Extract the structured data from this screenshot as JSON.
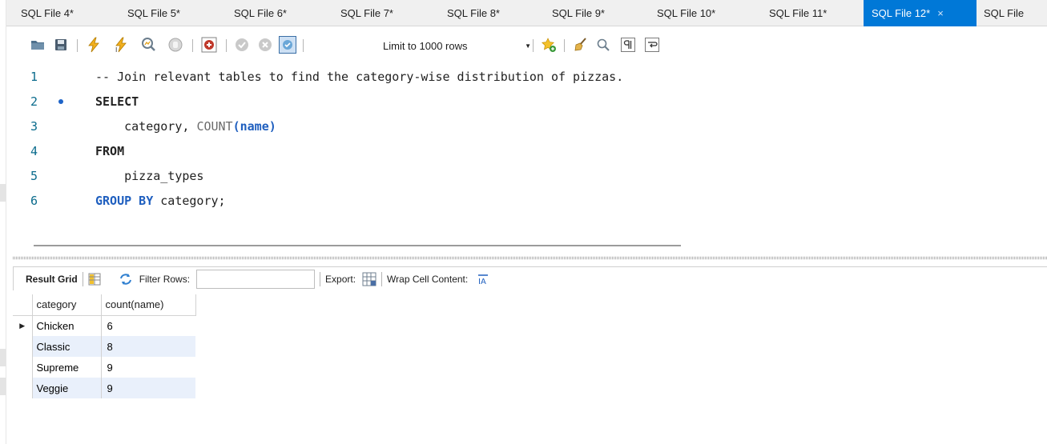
{
  "tabs": [
    {
      "label": "SQL File 4*"
    },
    {
      "label": "SQL File 5*"
    },
    {
      "label": "SQL File 6*"
    },
    {
      "label": "SQL File 7*"
    },
    {
      "label": "SQL File 8*"
    },
    {
      "label": "SQL File 9*"
    },
    {
      "label": "SQL File 10*"
    },
    {
      "label": "SQL File 11*"
    },
    {
      "label": "SQL File 12*",
      "active": true,
      "close": "×"
    },
    {
      "label": "SQL File"
    }
  ],
  "toolbar": {
    "limit_select": "Limit to 1000 rows",
    "icons": [
      "open-folder-icon",
      "save-icon",
      "execute-lightning-icon",
      "execute-current-lightning-icon",
      "explain-magnifier-icon",
      "stop-icon",
      "toggle-error-icon",
      "commit-check-icon",
      "rollback-icon",
      "autocommit-icon",
      "add-snippet-star-icon",
      "beautify-broom-icon",
      "find-magnifier-icon",
      "invisible-chars-icon",
      "word-wrap-icon"
    ]
  },
  "editor": {
    "lines": [
      {
        "num": "1",
        "comment": "-- Join relevant tables to find the category-wise distribution of pizzas."
      },
      {
        "num": "2",
        "keyword": "SELECT",
        "marker": true
      },
      {
        "num": "3",
        "indent": "    ",
        "ident": "category, ",
        "fn": "COUNT",
        "paren_open": "(",
        "arg": "name",
        "paren_close": ")"
      },
      {
        "num": "4",
        "keyword": "FROM"
      },
      {
        "num": "5",
        "indent": "    ",
        "ident": "pizza_types"
      },
      {
        "num": "6",
        "keyword": "GROUP BY",
        "rest": " category;"
      }
    ]
  },
  "result_toolbar": {
    "result_grid": "Result Grid",
    "filter_rows": "Filter Rows:",
    "export": "Export:",
    "wrap": "Wrap Cell Content:"
  },
  "grid": {
    "columns": [
      "category",
      "count(name)"
    ],
    "rows": [
      {
        "category": "Chicken",
        "count": "6",
        "current": true
      },
      {
        "category": "Classic",
        "count": "8"
      },
      {
        "category": "Supreme",
        "count": "9"
      },
      {
        "category": "Veggie",
        "count": "9"
      }
    ],
    "row_marker": "▶"
  },
  "colors": {
    "active_tab": "#0078d7",
    "keyword": "#1f5fbf",
    "comment": "#2a8fbd",
    "alt_row": "#e9f0fb"
  }
}
